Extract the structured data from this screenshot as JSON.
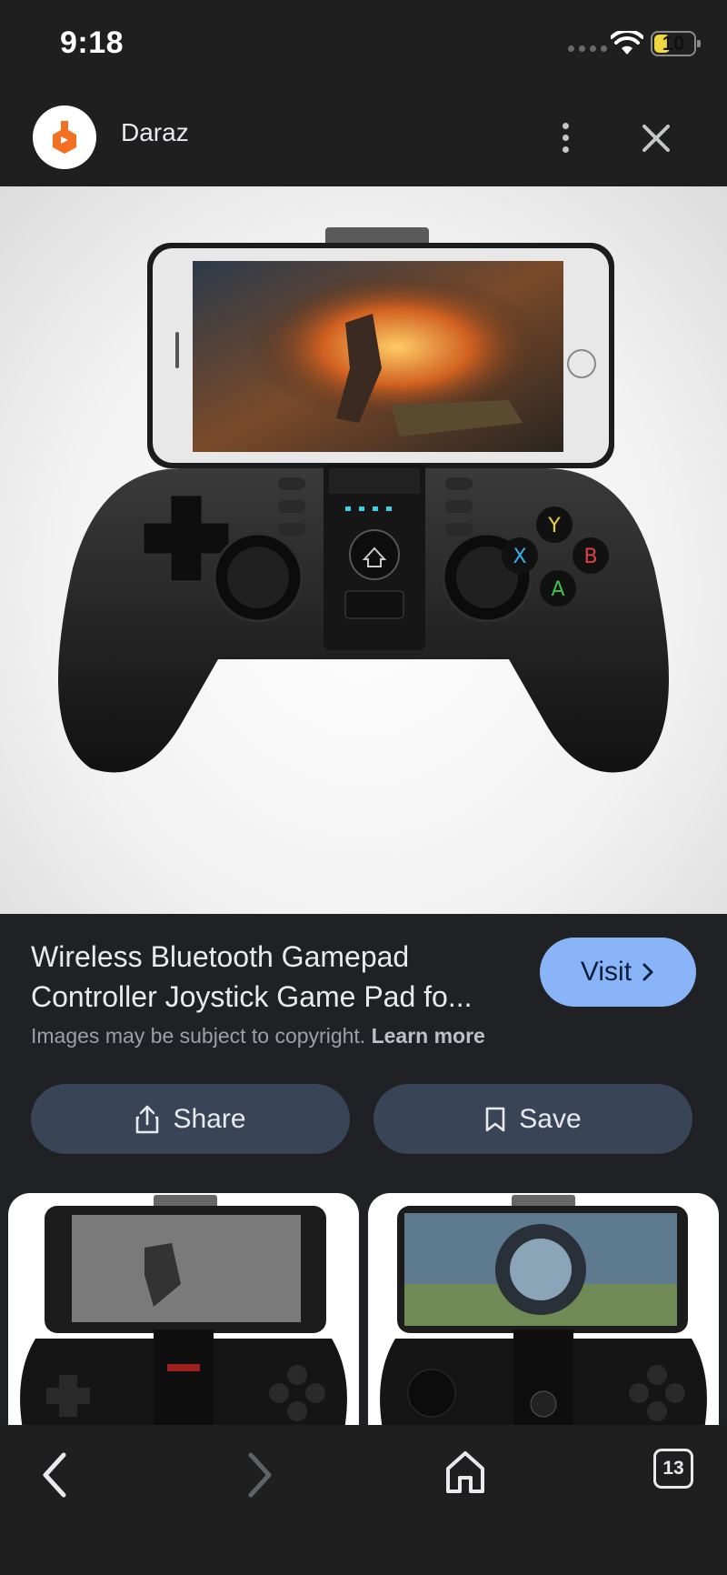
{
  "status_bar": {
    "time": "9:18",
    "battery": "10"
  },
  "header": {
    "site_name": "Daraz",
    "logo_icon": "daraz-logo",
    "more_icon": "more-vertical-icon",
    "close_icon": "close-icon"
  },
  "product": {
    "title": "Wireless Bluetooth Gamepad Controller Joystick Game Pad fo...",
    "visit_label": "Visit",
    "copyright_text": "Images may be subject to copyright.",
    "learn_more_label": "Learn more"
  },
  "actions": {
    "share_label": "Share",
    "save_label": "Save"
  },
  "bottom_nav": {
    "tab_count": "13"
  },
  "colors": {
    "background": "#202124",
    "visit_button": "#8ab4f8",
    "action_button": "#394457",
    "brand": "#f36f21"
  }
}
